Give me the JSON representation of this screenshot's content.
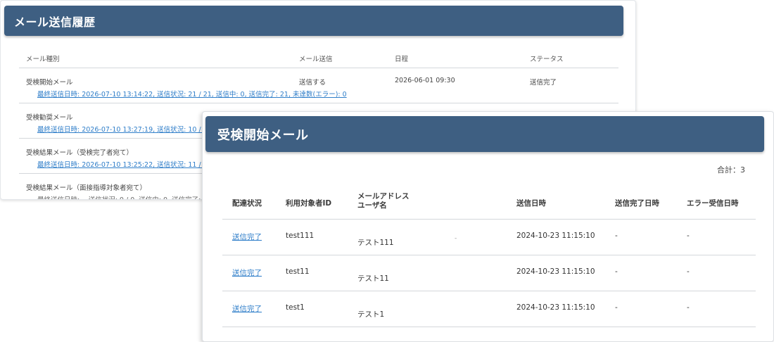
{
  "back": {
    "title": "メール送信履歴",
    "columns": [
      "メール種別",
      "メール送信",
      "日程",
      "ステータス"
    ],
    "rows": [
      {
        "type": "受検開始メール",
        "send": "送信する",
        "date": "2026-06-01 09:30",
        "status": "送信完了",
        "sub": "最終送信日時: 2026-07-10 13:14:22, 送信状況: 21 / 21, 送信中: 0, 送信完了: 21, 未達数(エラー): 0"
      },
      {
        "type": "受検勧奨メール",
        "sub": "最終送信日時: 2026-07-10 13:27:19, 送信状況: 10 / 10, ..."
      },
      {
        "type": "受検結果メール（受検完了者宛て）",
        "sub": "最終送信日時: 2026-07-10 13:25:22, 送信状況: 11 / 11, ..."
      },
      {
        "type": "受検結果メール（面接指導対象者宛て）",
        "sub": "最終送信日時: -, 送信状況: 0 / 0, 送信中: 0, 送信完了: 0"
      }
    ]
  },
  "front": {
    "title": "受検開始メール",
    "total": "合計：3",
    "headers": {
      "status": "配達状況",
      "user_id": "利用対象者ID",
      "email_label": "メールアドレス",
      "user_name_label": "ユーザ名",
      "sent_at": "送信日時",
      "done_at": "送信完了日時",
      "error_at": "エラー受信日時"
    },
    "rows": [
      {
        "status": "送信完了",
        "user_id": "test111",
        "user_name": "テスト111",
        "email": "-",
        "sent_at": "2024-10-23 11:15:10",
        "done_at": "-",
        "error_at": "-"
      },
      {
        "status": "送信完了",
        "user_id": "test11",
        "user_name": "テスト11",
        "email": "",
        "sent_at": "2024-10-23 11:15:10",
        "done_at": "-",
        "error_at": "-"
      },
      {
        "status": "送信完了",
        "user_id": "test1",
        "user_name": "テスト1",
        "email": "",
        "sent_at": "2024-10-23 11:15:10",
        "done_at": "-",
        "error_at": "-"
      }
    ]
  }
}
